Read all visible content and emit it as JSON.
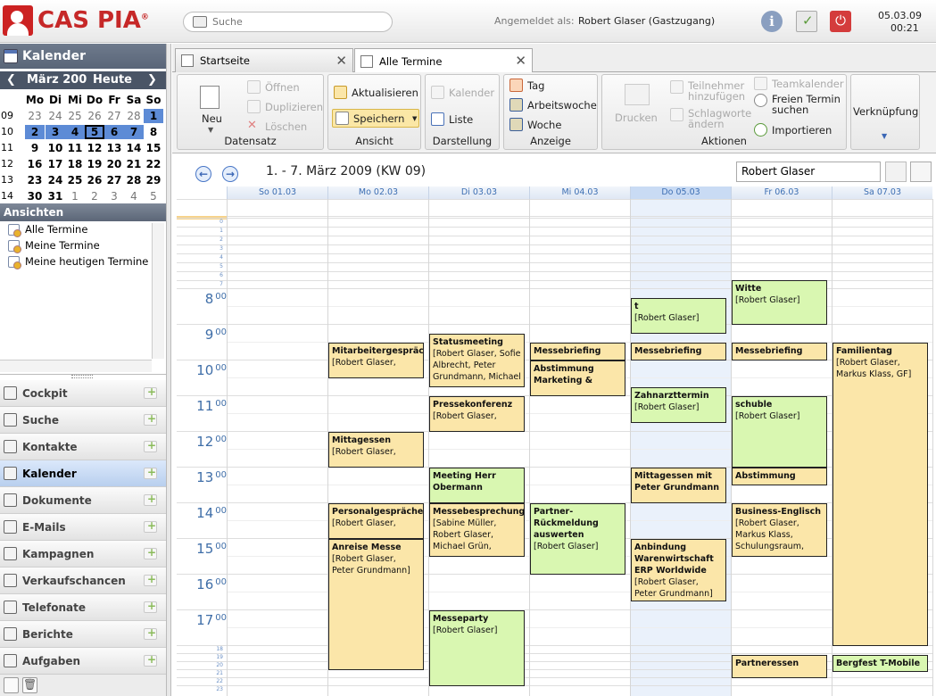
{
  "app": {
    "logo": "CAS PIA",
    "logo_mark": "®"
  },
  "top": {
    "search_placeholder": "Suche",
    "login_label": "Angemeldet als:",
    "login_name": "Robert Glaser (Gastzugang)",
    "date": "05.03.09",
    "time": "00:21",
    "icons": [
      "info-icon",
      "tasks-icon",
      "power-icon"
    ]
  },
  "sidebar": {
    "title": "Kalender",
    "mini": {
      "month": "März 200",
      "today": "Heute",
      "headers": [
        "Mo",
        "Di",
        "Mi",
        "Do",
        "Fr",
        "Sa",
        "So"
      ],
      "weeks": [
        {
          "wk": "09",
          "days": [
            "23",
            "24",
            "25",
            "26",
            "27",
            "28",
            "1"
          ]
        },
        {
          "wk": "10",
          "days": [
            "2",
            "3",
            "4",
            "5",
            "6",
            "7",
            "8"
          ]
        },
        {
          "wk": "11",
          "days": [
            "9",
            "10",
            "11",
            "12",
            "13",
            "14",
            "15"
          ]
        },
        {
          "wk": "12",
          "days": [
            "16",
            "17",
            "18",
            "19",
            "20",
            "21",
            "22"
          ]
        },
        {
          "wk": "13",
          "days": [
            "23",
            "24",
            "25",
            "26",
            "27",
            "28",
            "29"
          ]
        },
        {
          "wk": "14",
          "days": [
            "30",
            "31",
            "1",
            "2",
            "3",
            "4",
            "5"
          ]
        }
      ]
    },
    "views_title": "Ansichten",
    "views": [
      "Alle Termine",
      "Meine Termine",
      "Meine heutigen Termine"
    ],
    "nav": [
      "Cockpit",
      "Suche",
      "Kontakte",
      "Kalender",
      "Dokumente",
      "E-Mails",
      "Kampagnen",
      "Verkaufschancen",
      "Telefonate",
      "Berichte",
      "Aufgaben"
    ],
    "nav_active": "Kalender"
  },
  "tabs": [
    {
      "label": "Startseite"
    },
    {
      "label": "Alle Termine"
    }
  ],
  "ribbon": {
    "datensatz": {
      "caption": "Datensatz",
      "neu": "Neu",
      "oeffnen": "Öffnen",
      "duplizieren": "Duplizieren",
      "loeschen": "Löschen"
    },
    "ansicht": {
      "caption": "Ansicht",
      "aktualisieren": "Aktualisieren",
      "speichern": "Speichern"
    },
    "darstellung": {
      "caption": "Darstellung",
      "kalender": "Kalender",
      "liste": "Liste"
    },
    "anzeige": {
      "caption": "Anzeige",
      "tag": "Tag",
      "arbeitswoche": "Arbeitswoche",
      "woche": "Woche"
    },
    "aktionen": {
      "caption": "Aktionen",
      "drucken": "Drucken",
      "teilnehmer": "Teilnehmer hinzufügen",
      "schlagworte": "Schlagworte ändern",
      "teamkalender": "Teamkalender",
      "freien_termin": "Freien Termin suchen",
      "importieren": "Importieren"
    },
    "verknuepfung": {
      "caption": "Verknüpfung"
    }
  },
  "calendar": {
    "range": "1. - 7. März 2009 (KW 09)",
    "person": "Robert Glaser",
    "days": [
      "So 01.03",
      "Mo 02.03",
      "Di 03.03",
      "Mi 04.03",
      "Do 05.03",
      "Fr 06.03",
      "Sa 07.03"
    ],
    "hours": [
      "8",
      "9",
      "10",
      "11",
      "12",
      "13",
      "14",
      "15",
      "16",
      "17"
    ],
    "hour_suffix": "00",
    "small_hours": [
      "0",
      "1",
      "2",
      "3",
      "4",
      "5",
      "6",
      "7",
      "18",
      "19",
      "20",
      "21",
      "22",
      "23"
    ],
    "events": {
      "e1": {
        "title": "Mitarbeitergespräc",
        "who": "[Robert Glaser,"
      },
      "e2": {
        "title": "Mittagessen",
        "who": "[Robert Glaser,"
      },
      "e3": {
        "title": "Personalgespräche",
        "who": "[Robert Glaser,"
      },
      "e4": {
        "title": "Anreise Messe",
        "who": "[Robert Glaser, Peter Grundmann]"
      },
      "e5": {
        "title": "Statusmeeting",
        "who": "[Robert Glaser, Sofie Albrecht, Peter Grundmann, Michael"
      },
      "e6": {
        "title": "Pressekonferenz",
        "who": "[Robert Glaser,"
      },
      "e7": {
        "title": "Meeting Herr Obermann",
        "who": ""
      },
      "e8": {
        "title": "Messebesprechung",
        "who": "[Sabine Müller, Robert Glaser, Michael Grün,"
      },
      "e9": {
        "title": "Messeparty",
        "who": "[Robert Glaser]"
      },
      "e10": {
        "title": "Messebriefing",
        "who": ""
      },
      "e11": {
        "title": "Abstimmung Marketing &",
        "who": ""
      },
      "e12": {
        "title": "Partner-Rückmeldung auswerten",
        "who": "[Robert Glaser]"
      },
      "e13": {
        "title": "t",
        "who": "[Robert Glaser]"
      },
      "e14": {
        "title": "Messebriefing",
        "who": ""
      },
      "e15": {
        "title": "Zahnarzttermin",
        "who": "[Robert Glaser]"
      },
      "e16": {
        "title": "Mittagessen mit Peter Grundmann",
        "who": ""
      },
      "e17": {
        "title": "Anbindung Warenwirtschaft ERP Worldwide",
        "who": "[Robert Glaser, Peter Grundmann]"
      },
      "e18": {
        "title": "Witte",
        "who": "[Robert Glaser]"
      },
      "e19": {
        "title": "Messebriefing",
        "who": ""
      },
      "e20": {
        "title": "schuble",
        "who": "[Robert Glaser]"
      },
      "e21": {
        "title": "Abstimmung",
        "who": ""
      },
      "e22": {
        "title": "Business-Englisch",
        "who": "[Robert Glaser, Markus Klass, Schulungsraum,"
      },
      "e23": {
        "title": "Partneressen",
        "who": ""
      },
      "e24": {
        "title": "Familientag",
        "who": "[Robert Glaser, Markus Klass, GF]"
      },
      "e25": {
        "title": "Bergfest T-Mobile",
        "who": ""
      }
    }
  }
}
